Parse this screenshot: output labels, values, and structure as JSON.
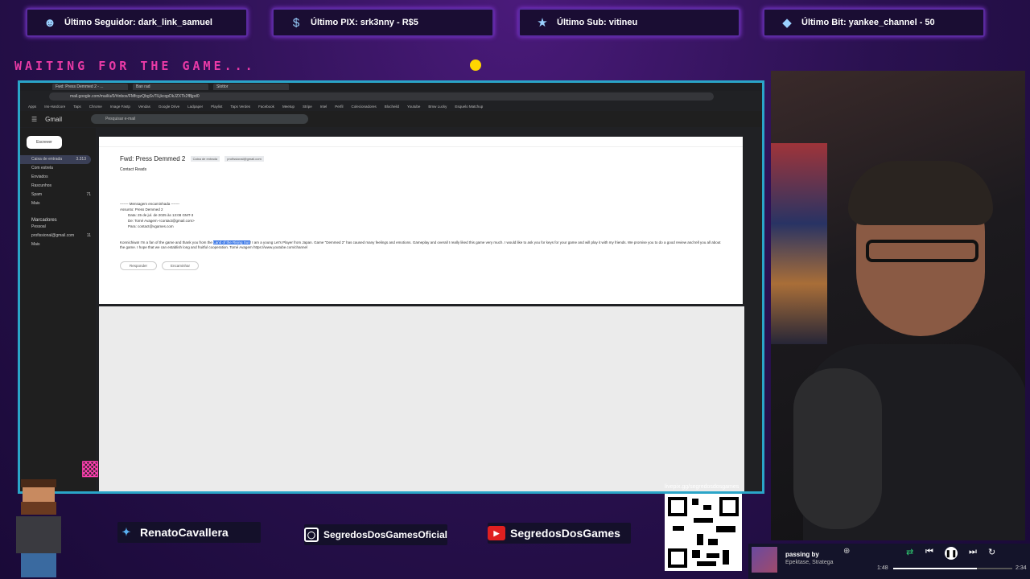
{
  "stats": [
    {
      "icon": "user-icon",
      "label": "Último Seguidor: dark_link_samuel"
    },
    {
      "icon": "dollar-icon",
      "label": "Último PIX: srk3nny - R$5"
    },
    {
      "icon": "star-icon",
      "label": "Último Sub: vitineu"
    },
    {
      "icon": "diamond-icon",
      "label": "Último Bit: yankee_channel - 50"
    }
  ],
  "waiting_text": "WAITING FOR THE GAME...",
  "browser": {
    "tabs": [
      "Fwd: Press Demmed 2 - ...",
      "Ban rad",
      "Slottor"
    ],
    "url": "mail.google.com/mail/u/0/#inbox/FMfcgzQbgSvTlLjkcqpDkJZXTk2fBjpd0",
    "bookmarks": [
      "Apps",
      "Ins-Hardcore",
      "Taps",
      "Chrome",
      "Image Fastp",
      "Vendas",
      "Google Drive",
      "Ladpaper",
      "Playlist",
      "Taps Verdes",
      "Facebook",
      "Meetup",
      "Stripe",
      "Intel",
      "Perfil",
      "Colecionadores",
      "Blocheild",
      "Youtube",
      "Bmw Lucky",
      "Esquelo Matchup"
    ]
  },
  "gmail": {
    "app_name": "Gmail",
    "search_placeholder": "Pesquisar e-mail",
    "compose": "Escrever",
    "nav": [
      {
        "label": "Caixa de entrada",
        "count": "3.313"
      },
      {
        "label": "Com estrela",
        "count": ""
      },
      {
        "label": "Enviados",
        "count": ""
      },
      {
        "label": "Rascunhos",
        "count": ""
      },
      {
        "label": "Spam",
        "count": "71"
      },
      {
        "label": "Mais",
        "count": ""
      }
    ],
    "labels_header": "Marcadores",
    "labels": [
      {
        "label": "Pessoal",
        "count": ""
      },
      {
        "label": "profissional@gmail.com",
        "count": "11"
      },
      {
        "label": "Mais",
        "count": ""
      }
    ],
    "email": {
      "subject": "Fwd: Press Demmed 2",
      "tags": [
        "Caixa de entrada",
        "profissional@gmail.com"
      ],
      "sender": "Contact Reads",
      "forward_header": "------- Mensagem encaminhada -------",
      "forward_subject": "Assunto: Press Demmed 2",
      "forward_date": "Data: 25 de jul. de 2025 às 13:08 GMT-3",
      "forward_from": "De: Tomé Avagem <contact@gmail.com>",
      "forward_to": "Para: contact@vgames.com",
      "text_before": "Konnichiwa! I'm a fan of the game and thank you from the ",
      "highlight": "Land of the Rising Sun",
      "text_after": "! I am a young Let's Player from Japan. Game \"Demmed 2\" has caused many feelings and emotions. Gameplay and overall I really liked this game very much. I would like to ask you for keys for your game and will play it with my friends. We promise you to do a good review and tell you all about the game. I hope that we can establish long and fruitful cooperation. Tomé Avagem https://www.youtube.com/channel",
      "reply_label": "Responder",
      "forward_label": "Encaminhar"
    }
  },
  "socials": {
    "twitter": "RenatoCavallera",
    "instagram": "SegredosDosGamesOficial",
    "youtube": "SegredosDosGames"
  },
  "qr_label": "livepix.gg/segredosdosgames",
  "player": {
    "title": "passing by",
    "artist": "Epektase, Stratega",
    "elapsed": "1:48",
    "total": "2:34",
    "progress": 0.7
  },
  "colors": {
    "neon_border": "#2aa5c8",
    "waiting_text": "#ff3fb0",
    "background": "#2a1150"
  }
}
